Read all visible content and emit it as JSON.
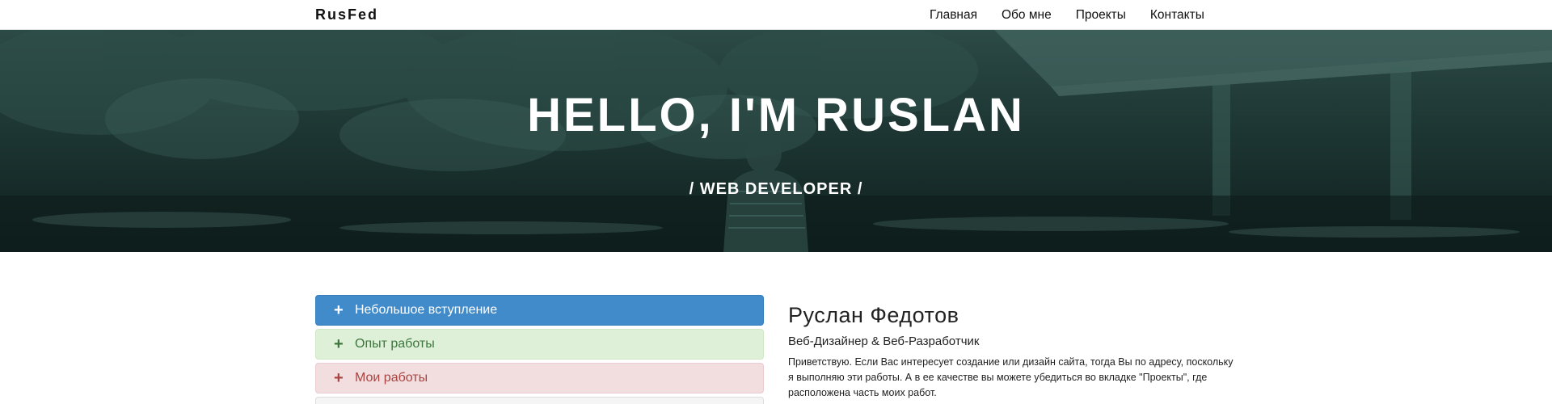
{
  "navbar": {
    "brand": "RusFed",
    "links": [
      "Главная",
      "Обо мне",
      "Проекты",
      "Контакты"
    ]
  },
  "hero": {
    "title": "HELLO, I'M RUSLAN",
    "subtitle": "/ WEB DEVELOPER /"
  },
  "accordion": {
    "items": [
      {
        "icon": "plus-icon",
        "label": "Небольшое вступление"
      },
      {
        "icon": "plus-icon",
        "label": "Опыт работы"
      },
      {
        "icon": "plus-icon",
        "label": "Мои работы"
      }
    ]
  },
  "about": {
    "name": "Руслан Федотов",
    "role": "Веб-Дизайнер & Веб-Разработчик",
    "text": "Приветствую. Если Вас интересует создание или дизайн сайта, тогда Вы по адресу, поскольку я выполняю эти работы. А в ее качестве вы можете убедиться во вкладке \"Проекты\", где расположена часть моих работ."
  },
  "colors": {
    "primary": "#428bca",
    "success_bg": "#dff0d8",
    "success_text": "#3c763d",
    "danger_bg": "#f2dede",
    "danger_text": "#a94442",
    "hero_overlay": "#1e3835"
  }
}
